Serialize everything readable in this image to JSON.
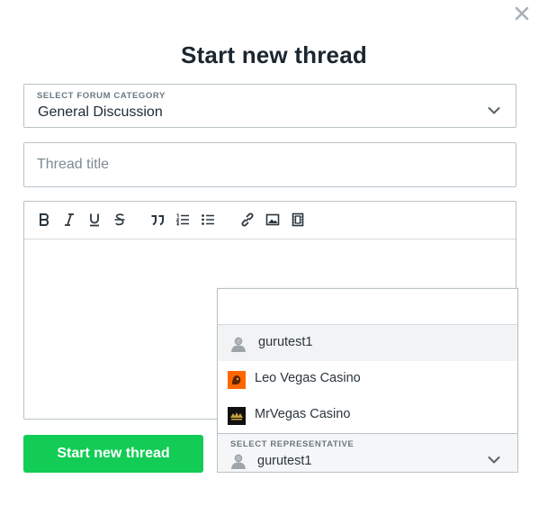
{
  "modal": {
    "title": "Start new thread",
    "close_icon": "close-icon"
  },
  "category": {
    "label": "SELECT FORUM CATEGORY",
    "value": "General Discussion"
  },
  "thread_title": {
    "value": "",
    "placeholder": "Thread title"
  },
  "toolbar": {
    "icons": [
      "bold-icon",
      "italic-icon",
      "underline-icon",
      "strikethrough-icon",
      "quote-icon",
      "ordered-list-icon",
      "bullet-list-icon",
      "link-icon",
      "image-icon",
      "video-icon"
    ]
  },
  "representative": {
    "label": "SELECT REPRESENTATIVE",
    "value": "gurutest1",
    "search_value": "",
    "options": [
      {
        "label": "gurutest1",
        "icon": "avatar-icon",
        "highlighted": true
      },
      {
        "label": "Leo Vegas Casino",
        "icon": "leo-vegas-logo",
        "highlighted": false
      },
      {
        "label": "MrVegas Casino",
        "icon": "mrvegas-logo",
        "highlighted": false
      }
    ]
  },
  "submit": {
    "label": "Start new thread"
  },
  "colors": {
    "submit_green": "#12cc55",
    "highlight_row": "#f2f3f4",
    "border": "#b9c3c9"
  }
}
